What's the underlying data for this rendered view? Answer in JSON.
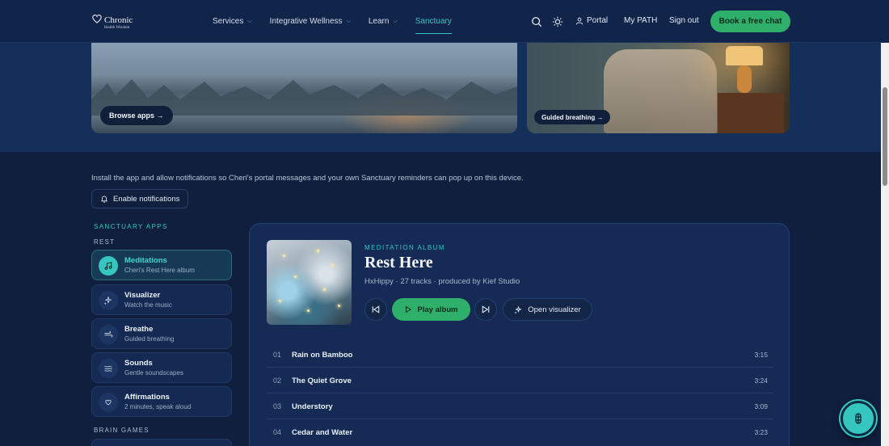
{
  "brand": {
    "logo_main": "Chronic",
    "logo_sub": "Health Wisdom"
  },
  "nav": {
    "items": [
      {
        "label": "Services",
        "has_menu": true
      },
      {
        "label": "Integrative Wellness",
        "has_menu": true
      },
      {
        "label": "Learn",
        "has_menu": true
      },
      {
        "label": "Sanctuary",
        "has_menu": false,
        "active": true
      }
    ],
    "portal": "Portal",
    "my_path": "My PATH",
    "sign_out": "Sign out",
    "cta": "Book a free chat"
  },
  "hero": {
    "browse_apps": "Browse apps →",
    "guided_breathing": "Guided breathing →"
  },
  "install": {
    "text": "Install the app and allow notifications so Cheri's portal messages and your own Sanctuary reminders can pop up on this device.",
    "notif_button": "Enable notifications"
  },
  "sidebar": {
    "section_label": "SANCTUARY APPS",
    "rest_label": "REST",
    "items": [
      {
        "title": "Meditations",
        "sub": "Cheri's Rest Here album",
        "icon": "music-note-icon",
        "active": true
      },
      {
        "title": "Visualizer",
        "sub": "Watch the music",
        "icon": "sparkles-icon"
      },
      {
        "title": "Breathe",
        "sub": "Guided breathing",
        "icon": "wind-icon"
      },
      {
        "title": "Sounds",
        "sub": "Gentle soundscapes",
        "icon": "waves-icon"
      },
      {
        "title": "Affirmations",
        "sub": "2 minutes, speak aloud",
        "icon": "heart-hand-icon"
      }
    ],
    "brain_games_label": "BRAIN GAMES"
  },
  "album": {
    "kicker": "MEDITATION ALBUM",
    "title": "Rest Here",
    "meta": "HxHippy · 27 tracks · produced by Kief Studio",
    "play": "Play album",
    "visualizer": "Open visualizer"
  },
  "tracks": [
    {
      "num": "01",
      "name": "Rain on Bamboo",
      "dur": "3:15"
    },
    {
      "num": "02",
      "name": "The Quiet Grove",
      "dur": "3:24"
    },
    {
      "num": "03",
      "name": "Understory",
      "dur": "3:09"
    },
    {
      "num": "04",
      "name": "Cedar and Water",
      "dur": "3:23"
    }
  ],
  "colors": {
    "accent": "#35c7bf",
    "cta": "#2fb06a",
    "bg": "#0f1f3d"
  }
}
